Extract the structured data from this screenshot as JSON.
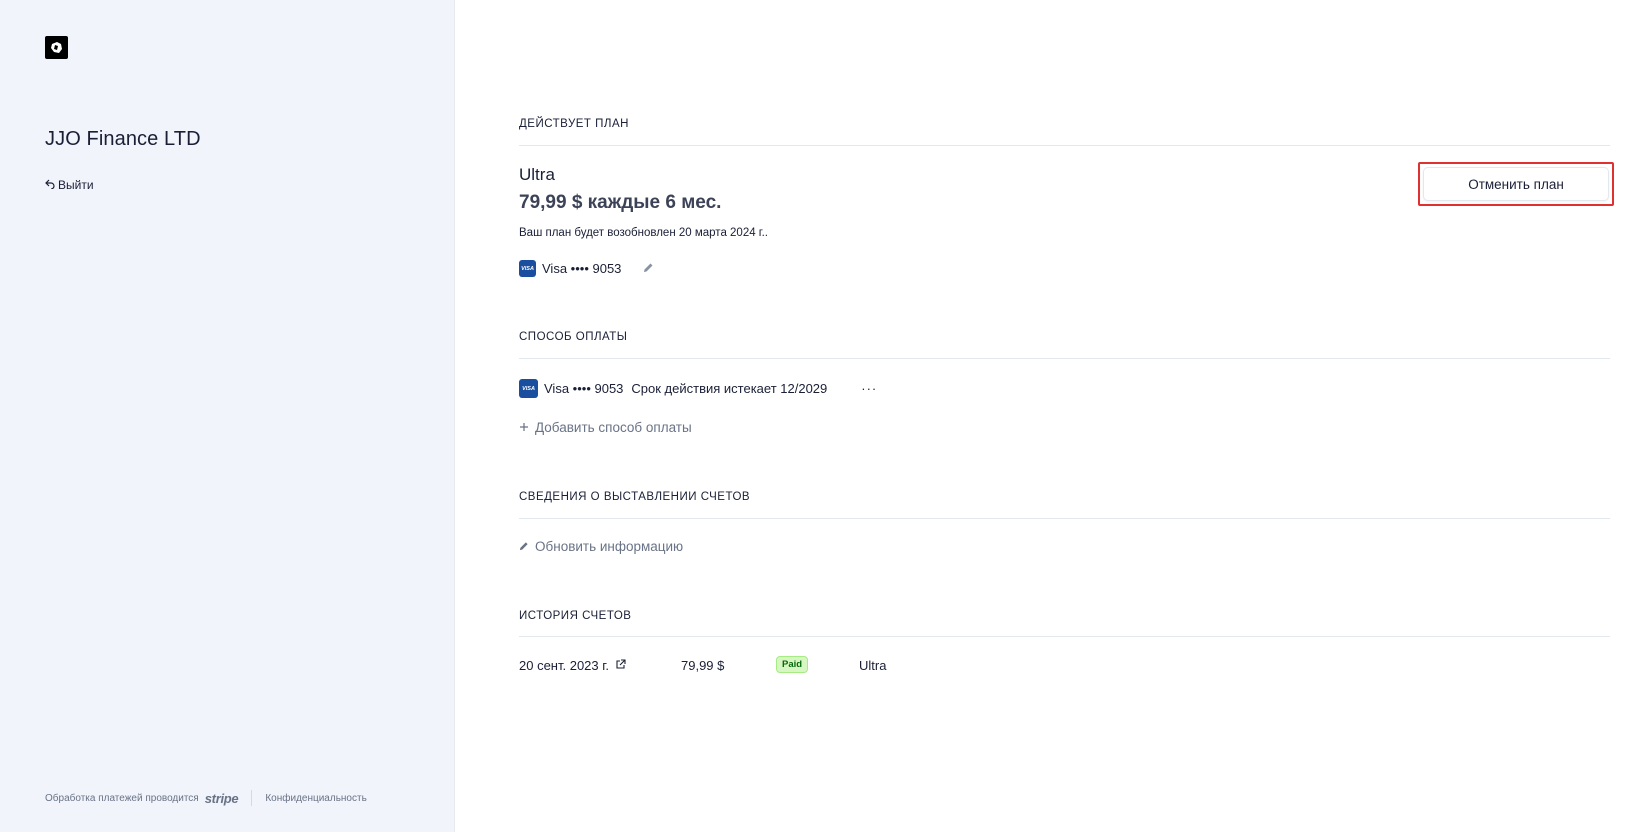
{
  "sidebar": {
    "company_name": "JJO Finance LTD",
    "logout_label": "Выйти",
    "footer": {
      "powered_by": "Обработка платежей проводится",
      "brand": "stripe",
      "privacy": "Конфиденциальность"
    }
  },
  "current_plan": {
    "section_title": "ДЕЙСТВУЕТ ПЛАН",
    "name": "Ultra",
    "price": "79,99 $ каждые 6 мес.",
    "renewal_text": "Ваш план будет возобновлен 20 марта 2024 г..",
    "card_label": "Visa •••• 9053",
    "cancel_button": "Отменить план"
  },
  "payment_method": {
    "section_title": "СПОСОБ ОПЛАТЫ",
    "card_label": "Visa •••• 9053",
    "expiry": "Срок действия истекает 12/2029",
    "more_label": "···",
    "add_label": "Добавить способ оплаты"
  },
  "billing_info": {
    "section_title": "СВЕДЕНИЯ О ВЫСТАВЛЕНИИ СЧЕТОВ",
    "update_label": "Обновить информацию"
  },
  "invoice_history": {
    "section_title": "ИСТОРИЯ СЧЕТОВ",
    "rows": [
      {
        "date": "20 сент. 2023 г.",
        "amount": "79,99 $",
        "status": "Paid",
        "plan": "Ultra"
      }
    ]
  },
  "icons": {
    "visa_text": "VISA"
  },
  "colors": {
    "sidebar_bg": "#f1f4fb",
    "highlight_border": "#e03131",
    "paid_badge_bg": "#d7f7c2",
    "paid_badge_text": "#05690d",
    "visa_blue": "#1a4fa0"
  }
}
